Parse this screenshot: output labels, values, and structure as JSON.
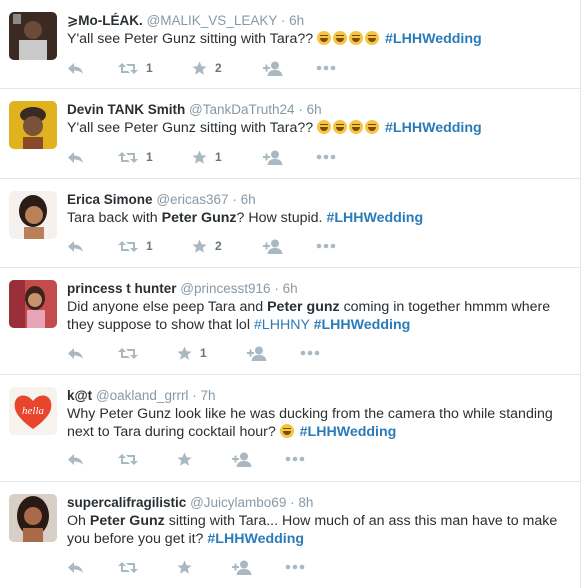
{
  "colors": {
    "hashtag": "#2b7bb9",
    "username": "#8899a6",
    "action_icon": "#aab8c2",
    "divider": "#e1e8ed"
  },
  "icons": {
    "reply": "reply-arrow-icon",
    "retweet": "retweet-icon",
    "favorite": "star-icon",
    "follow": "add-user-icon",
    "more": "more-dots-icon"
  },
  "tweets": [
    {
      "fullname": "⩾Mo-LÉAK.",
      "username": "@MALIK_VS_LEAKY",
      "time": "6h",
      "text_parts": [
        "Y'all see Peter Gunz sitting with Tara?? "
      ],
      "hashtag": "#LHHWedding",
      "retweets": "1",
      "favorites": "2"
    },
    {
      "fullname": "Devin TANK Smith",
      "username": "@TankDaTruth24",
      "time": "6h",
      "text_parts": [
        "Y'all see Peter Gunz sitting with Tara?? "
      ],
      "hashtag": "#LHHWedding",
      "retweets": "1",
      "favorites": "1"
    },
    {
      "fullname": "Erica Simone",
      "username": "@ericas367",
      "time": "6h",
      "text_parts": [
        "Tara back with ",
        "Peter Gunz",
        "? How stupid. "
      ],
      "hashtag": "#LHHWedding",
      "retweets": "1",
      "favorites": "2"
    },
    {
      "fullname": "princess t hunter",
      "username": "@princesst916",
      "time": "6h",
      "text_parts": [
        "Did anyone else peep Tara and ",
        "Peter gunz",
        " coming in together hmmm where they suppose to show that lol "
      ],
      "hashtag_extra": "#LHHNY",
      "hashtag": "#LHHWedding",
      "retweets": "",
      "favorites": "1"
    },
    {
      "fullname": "k@t",
      "username": "@oakland_grrrl",
      "time": "7h",
      "text_parts": [
        "Why Peter Gunz look like he was ducking from the camera tho while standing next to Tara during cocktail hour? "
      ],
      "hashtag": "#LHHWedding",
      "avatar_text": "hella",
      "retweets": "",
      "favorites": ""
    },
    {
      "fullname": "supercalifragilistic",
      "username": "@Juicylambo69",
      "time": "8h",
      "text_parts": [
        "Oh ",
        "Peter Gunz",
        " sitting with Tara... How much of an ass this man have to make you before you get it? "
      ],
      "hashtag": "#LHHWedding",
      "retweets": "",
      "favorites": ""
    }
  ]
}
